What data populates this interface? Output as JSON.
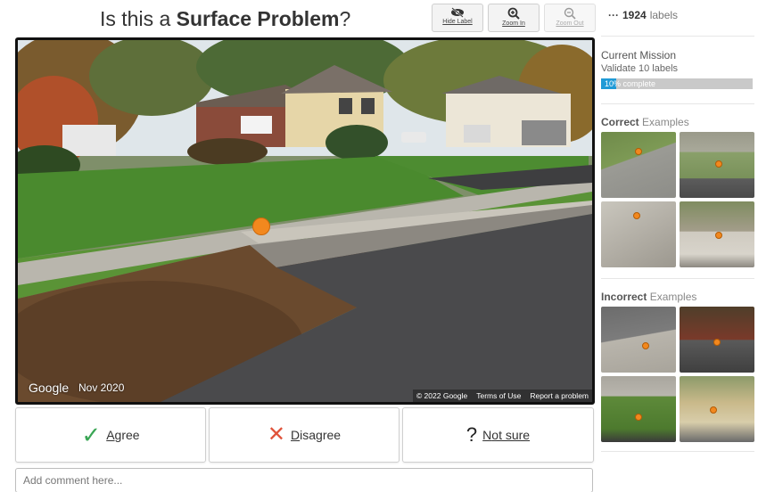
{
  "header": {
    "question_prefix": "Is this a ",
    "label_type": "Surface Problem",
    "question_suffix": "?"
  },
  "toolbar": {
    "hide_label": "Hide Label",
    "zoom_in": "Zoom In",
    "zoom_out": "Zoom Out"
  },
  "panorama": {
    "google_logo": "Google",
    "capture_date": "Nov 2020",
    "copyright": "© 2022 Google",
    "terms": "Terms of Use",
    "report": "Report a problem"
  },
  "validation": {
    "agree": {
      "icon": "✓",
      "first": "A",
      "rest": "gree"
    },
    "disagree": {
      "icon": "✕",
      "first": "D",
      "rest": "isagree"
    },
    "not_sure": {
      "icon": "?",
      "first": "N",
      "rest": "ot sure"
    }
  },
  "comment": {
    "placeholder": "Add comment here..."
  },
  "sidebar": {
    "menu_icon": "ellipsis-icon",
    "label_count": "1924",
    "label_count_suffix": "labels",
    "mission_title": "Current Mission",
    "mission_goal": "Validate 10 labels",
    "mission_progress_text": "10% complete",
    "mission_progress": 0.1,
    "correct_head_bold": "Correct",
    "correct_head_rest": " Examples",
    "incorrect_head_bold": "Incorrect",
    "incorrect_head_rest": " Examples"
  },
  "colors": {
    "accent": "#1f9ad6",
    "agree_check": "#3aa655",
    "disagree_x": "#e0523a",
    "label_marker": "#f2881e"
  }
}
